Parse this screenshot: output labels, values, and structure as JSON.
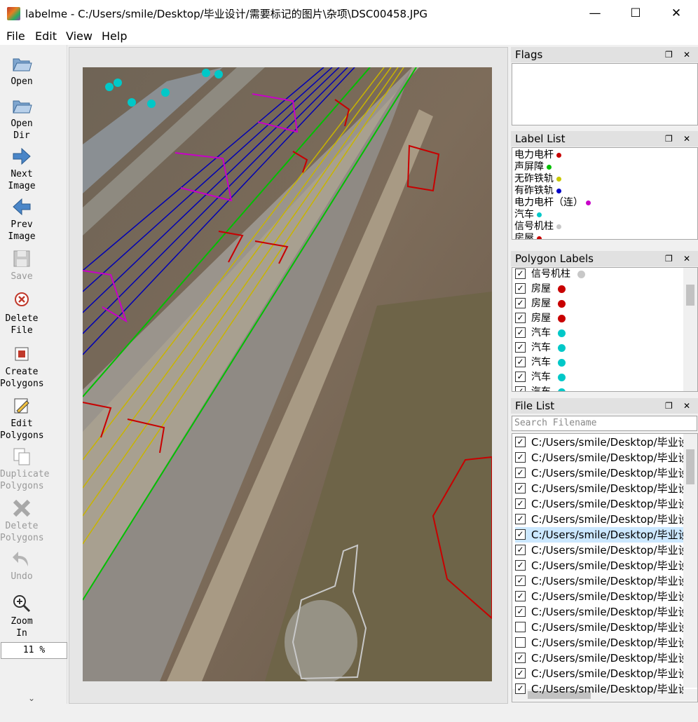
{
  "window": {
    "title": "labelme - C:/Users/smile/Desktop/毕业设计/需要标记的图片\\杂项\\DSC00458.JPG",
    "minimize": "—",
    "maximize": "☐",
    "close": "✕"
  },
  "menu": [
    "File",
    "Edit",
    "View",
    "Help"
  ],
  "tools": [
    {
      "label": "Open",
      "icon": "folder-open-icon"
    },
    {
      "label": "Open\nDir",
      "icon": "folder-icon"
    },
    {
      "label": "Next\nImage",
      "icon": "arrow-right-icon"
    },
    {
      "label": "Prev\nImage",
      "icon": "arrow-left-icon"
    },
    {
      "label": "Save",
      "icon": "save-icon"
    },
    {
      "label": "Delete\nFile",
      "icon": "delete-file-icon"
    },
    {
      "label": "Create\nPolygons",
      "icon": "create-polygon-icon"
    },
    {
      "label": "Edit\nPolygons",
      "icon": "edit-polygon-icon"
    },
    {
      "label": "Duplicate\nPolygons",
      "icon": "duplicate-icon"
    },
    {
      "label": "Delete\nPolygons",
      "icon": "delete-icon"
    },
    {
      "label": "Undo",
      "icon": "undo-icon"
    },
    {
      "label": "Zoom\nIn",
      "icon": "zoom-in-icon"
    }
  ],
  "zoom": "11 %",
  "flags": {
    "title": "Flags"
  },
  "label_list": {
    "title": "Label List",
    "items": [
      {
        "label": "电力电杆",
        "color": "#c80000"
      },
      {
        "label": "声屏障",
        "color": "#00c000"
      },
      {
        "label": "无砟铁轨",
        "color": "#c8c800"
      },
      {
        "label": "有砟铁轨",
        "color": "#0000c8"
      },
      {
        "label": "电力电杆（连）",
        "color": "#c800c8"
      },
      {
        "label": "汽车",
        "color": "#00c8c8"
      },
      {
        "label": "信号机柱",
        "color": "#c8c8c8"
      },
      {
        "label": "房屋",
        "color": "#c80000"
      }
    ]
  },
  "polygon_labels": {
    "title": "Polygon Labels",
    "items": [
      {
        "label": "信号机柱",
        "color": "#c8c8c8"
      },
      {
        "label": "房屋",
        "color": "#c80000"
      },
      {
        "label": "房屋",
        "color": "#c80000"
      },
      {
        "label": "房屋",
        "color": "#c80000"
      },
      {
        "label": "汽车",
        "color": "#00c8c8"
      },
      {
        "label": "汽车",
        "color": "#00c8c8"
      },
      {
        "label": "汽车",
        "color": "#00c8c8"
      },
      {
        "label": "汽车",
        "color": "#00c8c8"
      },
      {
        "label": "汽车",
        "color": "#00c8c8"
      }
    ]
  },
  "file_list": {
    "title": "File List",
    "search_placeholder": "Search Filename",
    "items": [
      {
        "path": "C:/Users/smile/Desktop/毕业设",
        "checked": true
      },
      {
        "path": "C:/Users/smile/Desktop/毕业设",
        "checked": true
      },
      {
        "path": "C:/Users/smile/Desktop/毕业设",
        "checked": true
      },
      {
        "path": "C:/Users/smile/Desktop/毕业设",
        "checked": true
      },
      {
        "path": "C:/Users/smile/Desktop/毕业设",
        "checked": true
      },
      {
        "path": "C:/Users/smile/Desktop/毕业设",
        "checked": true
      },
      {
        "path": "C:/Users/smile/Desktop/毕业设",
        "checked": true,
        "selected": true
      },
      {
        "path": "C:/Users/smile/Desktop/毕业设",
        "checked": true
      },
      {
        "path": "C:/Users/smile/Desktop/毕业设",
        "checked": true
      },
      {
        "path": "C:/Users/smile/Desktop/毕业设",
        "checked": true
      },
      {
        "path": "C:/Users/smile/Desktop/毕业设",
        "checked": true
      },
      {
        "path": "C:/Users/smile/Desktop/毕业设",
        "checked": true
      },
      {
        "path": "C:/Users/smile/Desktop/毕业设",
        "checked": false
      },
      {
        "path": "C:/Users/smile/Desktop/毕业设",
        "checked": false
      },
      {
        "path": "C:/Users/smile/Desktop/毕业设",
        "checked": true
      },
      {
        "path": "C:/Users/smile/Desktop/毕业设",
        "checked": true
      },
      {
        "path": "C:/Users/smile/Desktop/毕业设",
        "checked": true
      }
    ]
  },
  "colors": {
    "accent_select": "#cce8ff",
    "canvas_bg": "#e6e6e6"
  }
}
